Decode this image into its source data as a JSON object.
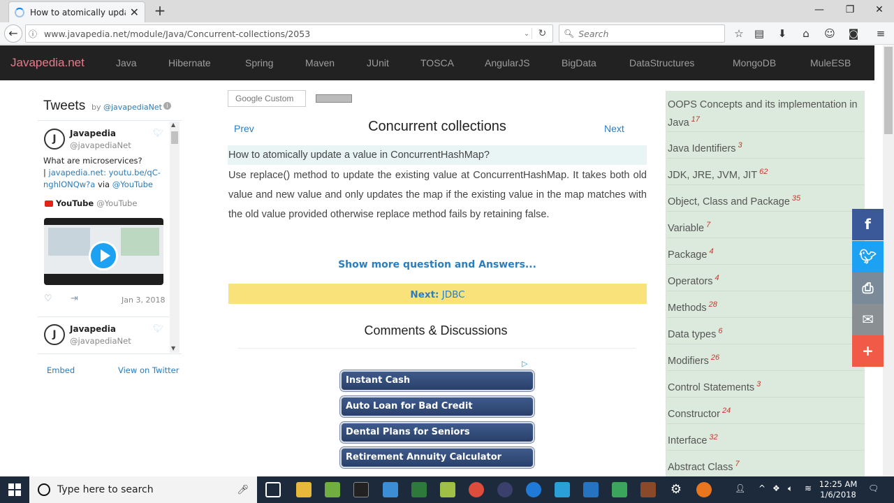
{
  "browser": {
    "tab_title": "How to atomically update...",
    "url": "www.javapedia.net/module/Java/Concurrent-collections/2053",
    "search_placeholder": "Search"
  },
  "site": {
    "brand": "Javapedia.net",
    "nav": [
      "Java",
      "Hibernate",
      "Spring",
      "Maven",
      "JUnit",
      "TOSCA",
      "AngularJS",
      "BigData",
      "DataStructures",
      "MongoDB",
      "MuleESB"
    ]
  },
  "twitter": {
    "title": "Tweets",
    "by": "by",
    "by_handle": "@javapediaNet",
    "tweet1": {
      "name": "Javapedia",
      "handle": "@javapediaNet",
      "text": "What are microservices?",
      "link": "javapedia.net: youtu.be/qC-nghlONQw?a",
      "via": "via",
      "via_handle": "@YouTube",
      "source_name": "YouTube",
      "source_handle": "@YouTube",
      "date": "Jan 3, 2018"
    },
    "tweet2": {
      "name": "Javapedia",
      "handle": "@javapediaNet"
    },
    "embed": "Embed",
    "view_on_twitter": "View on Twitter"
  },
  "main": {
    "google_search": "Google Custom",
    "prev": "Prev",
    "next": "Next",
    "title": "Concurrent collections",
    "question": "How to atomically update a value in ConcurrentHashMap?",
    "answer": "Use replace() method to update the existing value at ConcurrentHashMap. It takes both old value and new value and only updates the map if the existing value in the map matches with the old value provided otherwise replace method fails by retaining false.",
    "show_more": "Show more question and Answers...",
    "next_label": "Next:",
    "next_topic": "JDBC",
    "comments": "Comments & Discussions",
    "ads": [
      "Instant Cash",
      "Auto Loan for Bad Credit",
      "Dental Plans for Seniors",
      "Retirement Annuity Calculator"
    ]
  },
  "sidebar": {
    "items": [
      {
        "label": "OOPS Concepts and its implementation in Java",
        "count": "17"
      },
      {
        "label": "Java Identifiers",
        "count": "3"
      },
      {
        "label": "JDK, JRE, JVM, JIT",
        "count": "62"
      },
      {
        "label": "Object, Class and Package",
        "count": "35"
      },
      {
        "label": "Variable",
        "count": "7"
      },
      {
        "label": "Package",
        "count": "4"
      },
      {
        "label": "Operators",
        "count": "4"
      },
      {
        "label": "Methods",
        "count": "28"
      },
      {
        "label": "Data types",
        "count": "6"
      },
      {
        "label": "Modifiers",
        "count": "26"
      },
      {
        "label": "Control Statements",
        "count": "3"
      },
      {
        "label": "Constructor",
        "count": "24"
      },
      {
        "label": "Interface",
        "count": "32"
      },
      {
        "label": "Abstract Class",
        "count": "7"
      }
    ]
  },
  "share": {
    "icons": [
      "facebook-icon",
      "twitter-icon",
      "print-icon",
      "email-icon",
      "plus-icon"
    ],
    "colors": [
      "#3b5998",
      "#1da1f2",
      "#7a8a99",
      "#8a8f94",
      "#f05a47"
    ]
  },
  "taskbar": {
    "search_placeholder": "Type here to search",
    "time": "12:25 AM",
    "date": "1/6/2018"
  }
}
